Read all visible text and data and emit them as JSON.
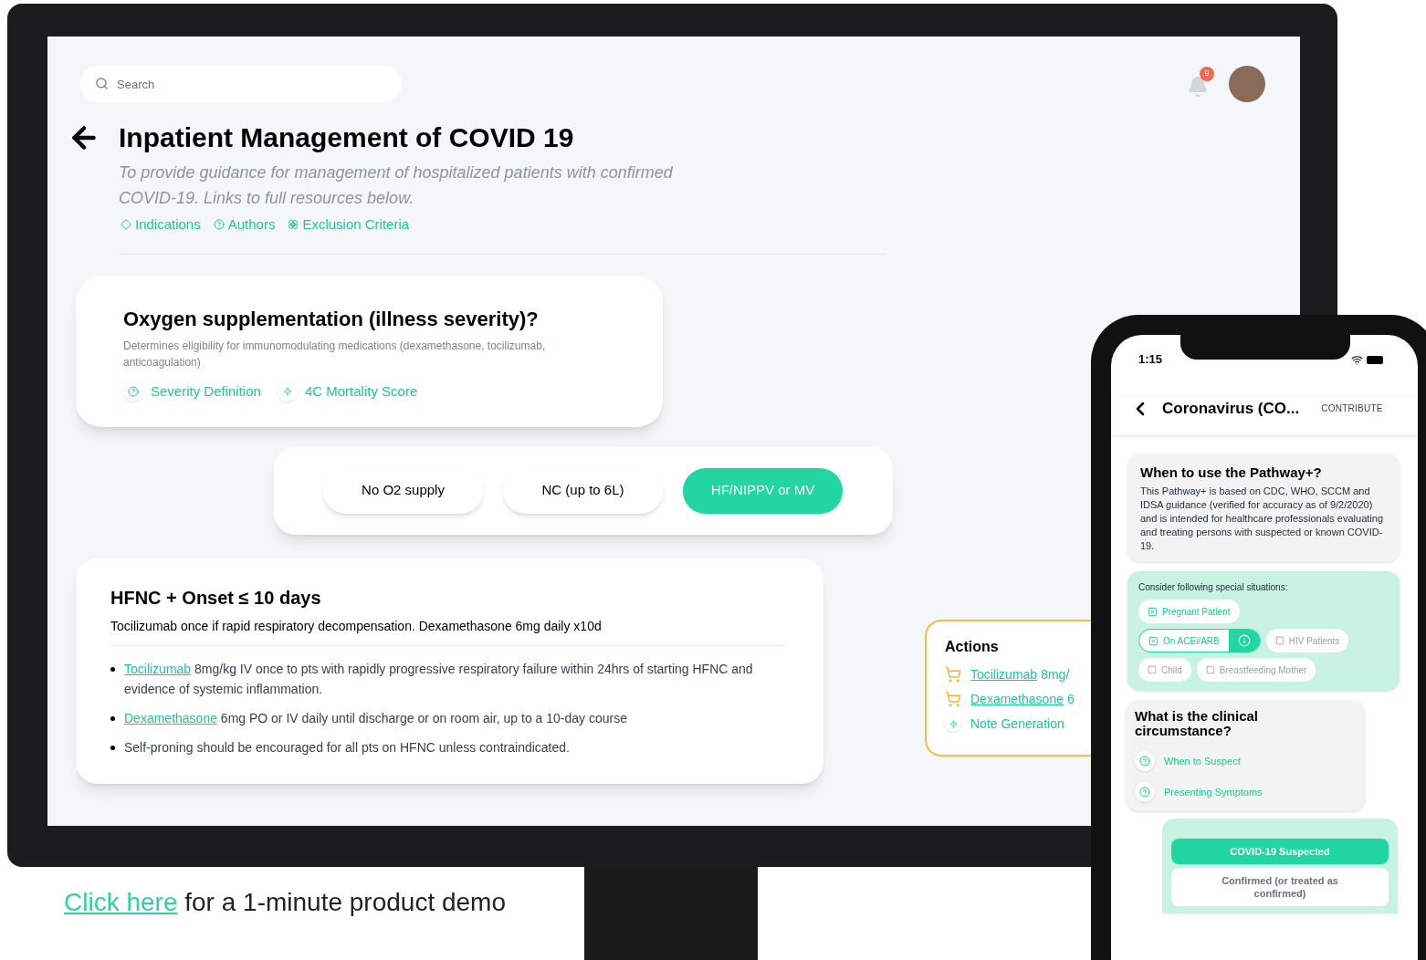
{
  "monitor": {
    "search": {
      "placeholder": "Search"
    },
    "notifications": {
      "count": "9"
    },
    "title": "Inpatient Management of COVID 19",
    "subtitle": "To provide guidance for management of hospitalized patients with confirmed COVID-19. Links to full resources below.",
    "links": [
      {
        "label": "Indications",
        "kind": "diamond"
      },
      {
        "label": "Authors",
        "kind": "help"
      },
      {
        "label": "Exclusion Criteria",
        "kind": "star"
      }
    ],
    "question_card": {
      "title": "Oxygen supplementation (illness severity)?",
      "description": "Determines eligibility for immunomodulating medications (dexamethasone, tocilizumab, anticoagulation)",
      "links": [
        {
          "label": "Severity Definition",
          "kind": "help"
        },
        {
          "label": "4C Mortality Score",
          "kind": "calculator"
        }
      ]
    },
    "options": [
      {
        "label": "No O2 supply",
        "selected": false
      },
      {
        "label": "NC (up to 6L)",
        "selected": false
      },
      {
        "label": "HF/NIPPV or MV",
        "selected": true
      }
    ],
    "result_card": {
      "title": "HFNC + Onset ≤ 10 days",
      "summary": "Tocilizumab once if rapid respiratory decompensation. Dexamethasone 6mg daily x10d",
      "bullets": [
        {
          "link": "Tocilizumab",
          "text": "8mg/kg IV once to pts with rapidly progressive respiratory failure within 24hrs of starting HFNC and evidence of systemic inflammation."
        },
        {
          "link": "Dexamethasone",
          "text": "6mg PO or IV daily until discharge or on room air, up to a 10-day course"
        },
        {
          "text": "Self-proning should be encouraged for all pts on HFNC unless contraindicated."
        }
      ]
    },
    "actions": {
      "title": "Actions",
      "items": [
        {
          "kind": "order",
          "link": "Tocilizumab",
          "text": "8mg/"
        },
        {
          "kind": "order",
          "link": "Dexamethasone",
          "text": "6"
        },
        {
          "kind": "note",
          "link": "Note Generation"
        }
      ]
    }
  },
  "caption": {
    "link": "Click here",
    "text": "for a 1-minute product demo"
  },
  "phone": {
    "time": "1:15",
    "title": "Coronavirus (CO...",
    "action": "CONTRIBUTE",
    "info_card": {
      "title": "When to use the Pathway+?",
      "body": "This Pathway+ is based on CDC, WHO, SCCM and IDSA guidance (verified for accuracy as of 9/2/2020) and is intended for healthcare professionals evaluating and treating persons with suspected or known COVID-19."
    },
    "situations": {
      "label": "Consider following special situations:",
      "items": [
        {
          "label": "Pregnant Patient",
          "checked": true,
          "info": false
        },
        {
          "label": "On ACEi/ARB",
          "checked": true,
          "info": true
        },
        {
          "label": "HIV Patients",
          "checked": false,
          "info": false
        },
        {
          "label": "Child",
          "checked": false,
          "info": false
        },
        {
          "label": "Breastfeeding Mother",
          "checked": false,
          "info": false
        }
      ]
    },
    "question": {
      "title": "What is the clinical circumstance?",
      "links": [
        "When to Suspect",
        "Presenting Symptoms"
      ]
    },
    "answers": [
      {
        "label": "COVID-19 Suspected",
        "selected": true
      },
      {
        "label": "Confirmed (or treated as confirmed)",
        "selected": false
      }
    ]
  }
}
